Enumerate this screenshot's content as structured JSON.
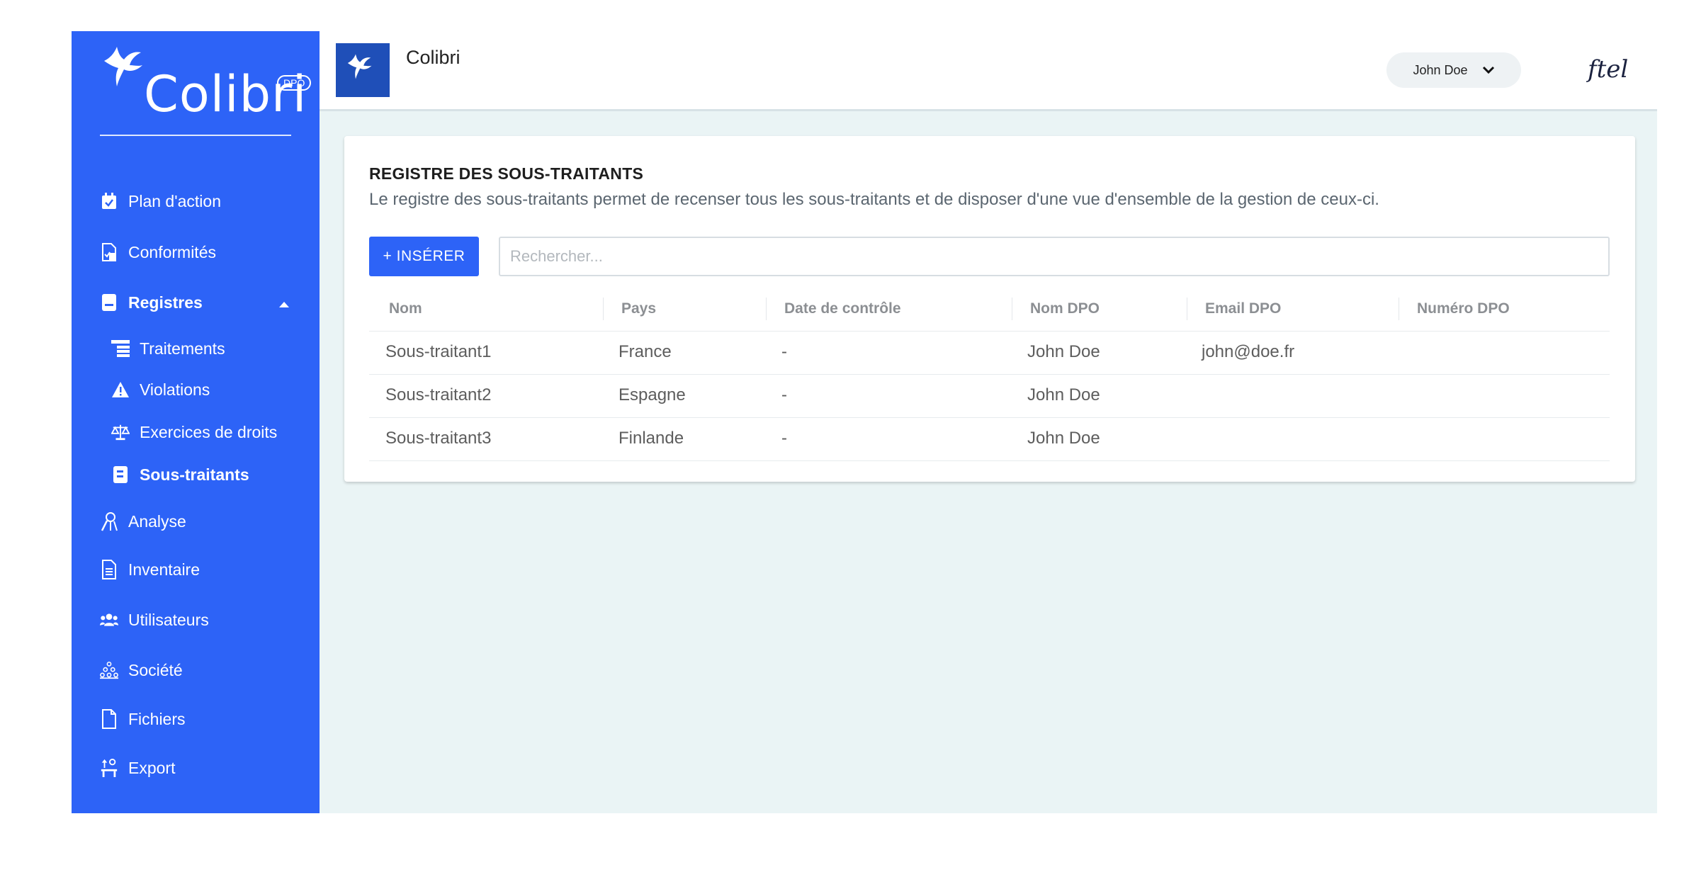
{
  "brand": {
    "logo_text": "Colibri",
    "logo_badge": "DPO",
    "app_title": "Colibri",
    "partner_logo": "ftel"
  },
  "sidebar": {
    "items": [
      {
        "label": "Plan d'action",
        "icon": "calendar-check-icon"
      },
      {
        "label": "Conformités",
        "icon": "document-check-icon"
      },
      {
        "label": "Registres",
        "icon": "book-icon",
        "expanded": true
      },
      {
        "label": "Traitements",
        "icon": "table-rows-icon"
      },
      {
        "label": "Violations",
        "icon": "warning-icon"
      },
      {
        "label": "Exercices de droits",
        "icon": "balance-scale-icon"
      },
      {
        "label": "Sous-traitants",
        "icon": "contact-card-icon",
        "active": true
      },
      {
        "label": "Analyse",
        "icon": "analysis-icon"
      },
      {
        "label": "Inventaire",
        "icon": "file-list-icon"
      },
      {
        "label": "Utilisateurs",
        "icon": "users-icon"
      },
      {
        "label": "Société",
        "icon": "company-icon"
      },
      {
        "label": "Fichiers",
        "icon": "file-icon"
      },
      {
        "label": "Export",
        "icon": "export-icon"
      }
    ]
  },
  "header": {
    "user_name": "John Doe"
  },
  "card": {
    "title": "REGISTRE DES SOUS-TRAITANTS",
    "description": "Le registre des sous-traitants permet de recenser tous les sous-traitants et de disposer d'une vue d'ensemble de la gestion de ceux-ci.",
    "insert_label": "+ INSÉRER",
    "search_placeholder": "Rechercher..."
  },
  "table": {
    "columns": [
      "Nom",
      "Pays",
      "Date de contrôle",
      "Nom DPO",
      "Email DPO",
      "Numéro DPO"
    ],
    "rows": [
      [
        "Sous-traitant1",
        "France",
        "-",
        "John Doe",
        "john@doe.fr",
        ""
      ],
      [
        "Sous-traitant2",
        "Espagne",
        "-",
        "John Doe",
        "",
        ""
      ],
      [
        "Sous-traitant3",
        "Finlande",
        "-",
        "John Doe",
        "",
        ""
      ]
    ]
  },
  "colors": {
    "primary": "#2d63f7",
    "background": "#eaf4f5"
  }
}
